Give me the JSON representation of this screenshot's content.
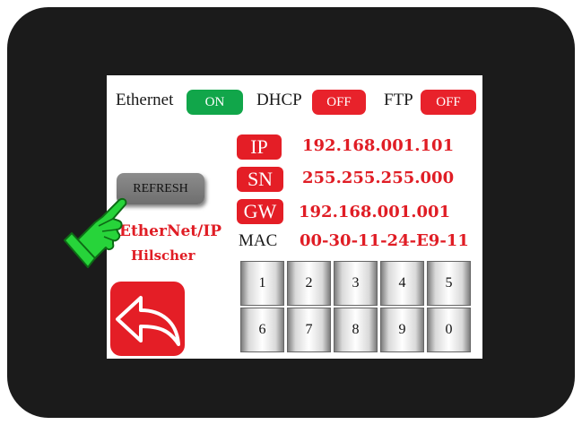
{
  "status_bar": {
    "ethernet": {
      "label": "Ethernet",
      "state": "ON",
      "color": "#11a64a"
    },
    "dhcp": {
      "label": "DHCP",
      "state": "OFF",
      "color": "#e8222b"
    },
    "ftp": {
      "label": "FTP",
      "state": "OFF",
      "color": "#e8222b"
    }
  },
  "network": {
    "ip": {
      "label": "IP",
      "value": "192.168.001.101"
    },
    "sn": {
      "label": "SN",
      "value": "255.255.255.000"
    },
    "gw": {
      "label": "GW",
      "value": "192.168.001.001"
    },
    "mac": {
      "label": "MAC",
      "value": "00-30-11-24-E9-11"
    }
  },
  "refresh_label": "REFRESH",
  "brand": {
    "line1": "EtherNet/IP",
    "line2": "Hilscher"
  },
  "keypad": {
    "keys": [
      "1",
      "2",
      "3",
      "4",
      "5",
      "6",
      "7",
      "8",
      "9",
      "0"
    ]
  },
  "icons": {
    "back": "back-arrow-icon",
    "pointer": "pointing-hand-icon"
  },
  "colors": {
    "accent_red": "#e41e26",
    "on_green": "#11a64a",
    "bezel": "#1b1b1b"
  }
}
